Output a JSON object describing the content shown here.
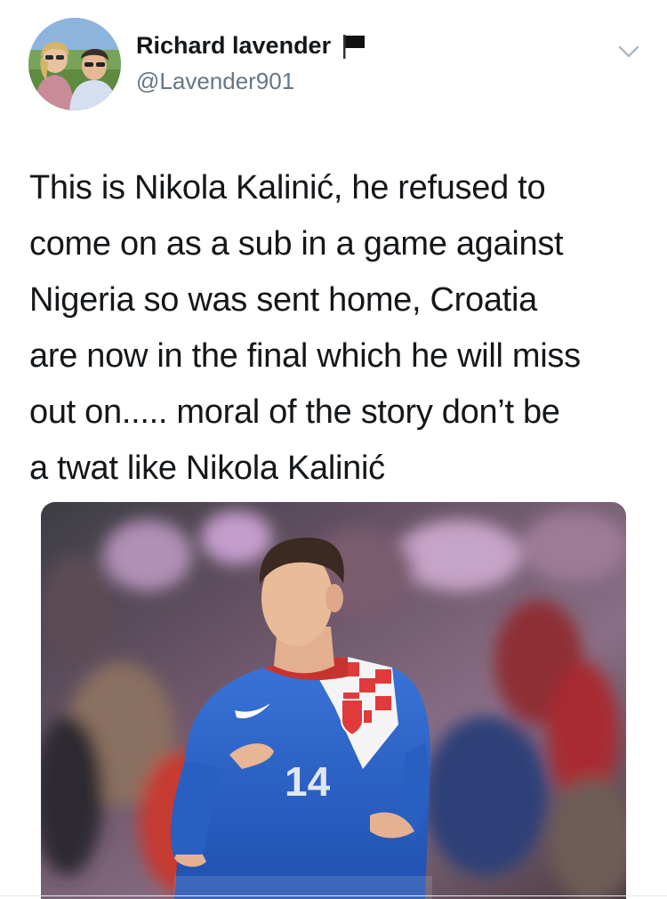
{
  "user": {
    "display_name": "Richard lavender",
    "handle": "@Lavender901",
    "avatar_icon": "profile-photo",
    "badge_icon": "black-flag-icon"
  },
  "menu": {
    "icon": "chevron-down-icon"
  },
  "tweet": {
    "text_lines": [
      "This is Nikola Kalinić, he refused to",
      "come on as a sub in a game against",
      "Nigeria so was sent home, Croatia",
      "are now in the final which he will miss",
      "out on..... moral of the story don’t be",
      "a twat like Nikola Kalinić"
    ]
  },
  "media": {
    "jersey_number": "14"
  },
  "colors": {
    "text": "#14171a",
    "secondary": "#657786",
    "jersey_blue": "#2a62c9",
    "checker_red": "#e03a3a"
  }
}
